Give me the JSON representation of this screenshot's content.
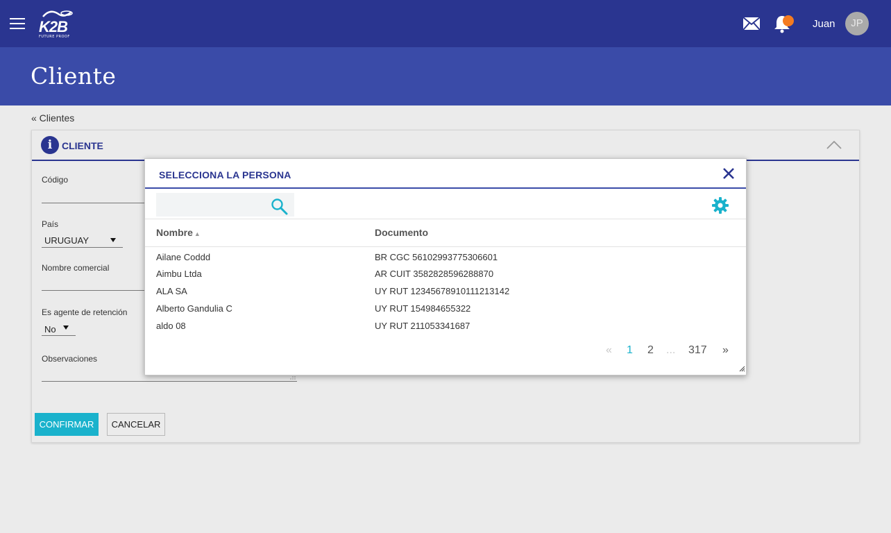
{
  "header": {
    "logo_text": "K2B",
    "logo_subtext": "FUTURE PROOF",
    "user_name": "Juan",
    "avatar_initials": "JP",
    "brand_color": "#2a3590",
    "notification_color": "#f47b20"
  },
  "page": {
    "title": "Cliente",
    "breadcrumb": "« Clientes"
  },
  "panel": {
    "title": "CLIENTE",
    "info_icon_glyph": "i",
    "fields": {
      "codigo_label": "Código",
      "pais_label": "País",
      "pais_value": "URUGUAY",
      "nombre_comercial_label": "Nombre comercial",
      "agente_label": "Es agente de retención",
      "agente_value": "No",
      "observaciones_label": "Observaciones"
    },
    "confirm_label": "CONFIRMAR",
    "cancel_label": "CANCELAR",
    "accent_color": "#1ab2cc"
  },
  "modal": {
    "title": "SELECCIONA LA PERSONA",
    "search_placeholder": "",
    "columns": {
      "nombre": "Nombre",
      "documento": "Documento",
      "sort_indicator": "▲"
    },
    "rows": [
      {
        "nombre": "Ailane Coddd",
        "documento": "BR CGC 56102993775306601"
      },
      {
        "nombre": "Aimbu Ltda",
        "documento": "AR CUIT 3582828596288870"
      },
      {
        "nombre": "ALA SA",
        "documento": "UY RUT 12345678910111213142"
      },
      {
        "nombre": "Alberto Gandulia C",
        "documento": "UY RUT 154984655322"
      },
      {
        "nombre": "aldo 08",
        "documento": "UY RUT 211053341687"
      }
    ],
    "pagination": {
      "prev": "«",
      "current": "1",
      "page2": "2",
      "ellipsis": "...",
      "last": "317",
      "next": "»"
    }
  }
}
